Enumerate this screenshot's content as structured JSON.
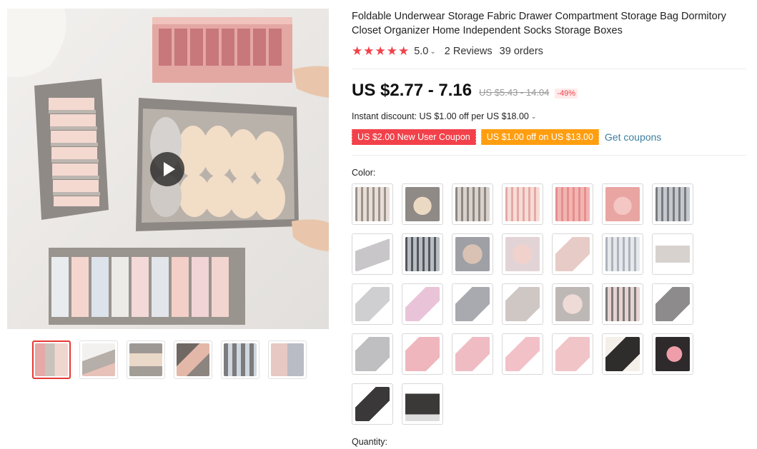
{
  "product": {
    "title": "Foldable Underwear Storage Fabric Drawer Compartment Storage Bag Dormitory Closet Organizer Home Independent Socks Storage Boxes",
    "rating": {
      "stars": "★★★★★",
      "value": "5.0",
      "chevron": "⌄",
      "reviews": "2 Reviews",
      "orders": "39 orders"
    },
    "price": {
      "current": "US $2.77 - 7.16",
      "original": "US $5.43 - 14.04",
      "discount": "-49%"
    },
    "instant_discount": {
      "text": "Instant discount: US $1.00 off per US $18.00",
      "chevron": "⌄"
    },
    "coupons": [
      {
        "label": "US $2.00 New User Coupon",
        "color": "#f2414a"
      },
      {
        "label": "US $1.00 off on US $13.00",
        "color": "#ff9e10"
      }
    ],
    "get_coupons": "Get coupons",
    "color_label": "Color:",
    "quantity_label": "Quantity:"
  },
  "gallery": {
    "play_icon": "play-icon",
    "thumbnail_count": 6,
    "active_thumbnail": 1
  },
  "theme": {
    "accent": "#f2414a",
    "link": "#3d7fa0",
    "coupon_orange": "#ff9e10"
  }
}
